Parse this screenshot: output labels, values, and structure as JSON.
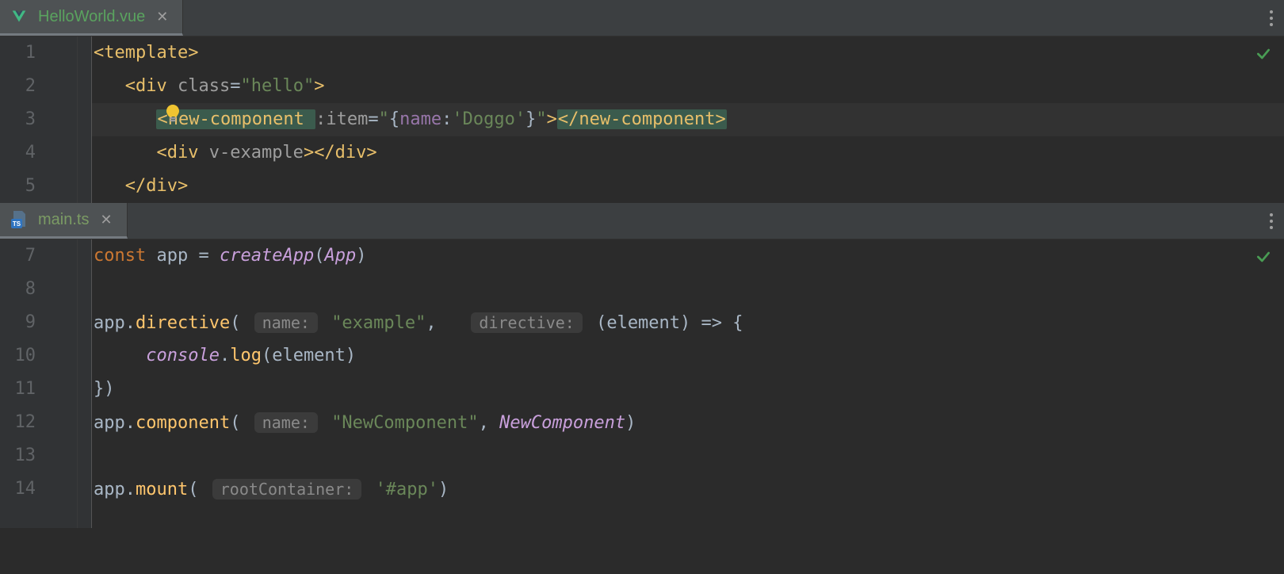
{
  "pane1": {
    "tab": {
      "title": "HelloWorld.vue"
    },
    "lines": {
      "l1": {
        "num": "1",
        "t_open": "<template>"
      },
      "l2": {
        "num": "2",
        "div_open": "<div ",
        "class_attr": "class",
        "eq": "=",
        "class_val": "\"hello\"",
        "close": ">"
      },
      "l3": {
        "num": "3",
        "nc_open": "<new-component ",
        "item_attr": ":item",
        "eq": "=",
        "q1": "\"",
        "brace1": "{",
        "name_key": "name",
        "colon": ":",
        "name_val": "'Doggo'",
        "brace2": "}",
        "q2": "\"",
        "tag_close": ">",
        "nc_close": "</new-component>"
      },
      "l4": {
        "num": "4",
        "div_open": "<div ",
        "vex": "v-example",
        "close": ">",
        "div_close": "</div>"
      },
      "l5": {
        "num": "5",
        "div_close": "</div>"
      }
    }
  },
  "pane2": {
    "tab": {
      "title": "main.ts"
    },
    "lines": {
      "l7": {
        "num": "7",
        "const_kw": "const ",
        "app": "app",
        "eq": " = ",
        "createApp": "createApp",
        "popen": "(",
        "App": "App",
        "pclose": ")"
      },
      "l8": {
        "num": "8"
      },
      "l9": {
        "num": "9",
        "app": "app",
        "dot": ".",
        "directive": "directive",
        "popen": "(",
        "hint_name": "name:",
        "name_val": "\"example\"",
        "comma": ", ",
        "hint_dir": "directive:",
        "arrow_args": "(element) ",
        "arrow": "=> {"
      },
      "l10": {
        "num": "10",
        "console": "console",
        "dot": ".",
        "log": "log",
        "popen": "(",
        "element": "element",
        "pclose": ")"
      },
      "l11": {
        "num": "11",
        "close": "})"
      },
      "l12": {
        "num": "12",
        "app": "app",
        "dot": ".",
        "component": "component",
        "popen": "(",
        "hint_name": "name:",
        "name_val": "\"NewComponent\"",
        "comma": ", ",
        "NewComponent": "NewComponent",
        "pclose": ")"
      },
      "l13": {
        "num": "13"
      },
      "l14": {
        "num": "14",
        "app": "app",
        "dot": ".",
        "mount": "mount",
        "popen": "(",
        "hint_root": "rootContainer:",
        "root_val": "'#app'",
        "pclose": ")"
      }
    }
  }
}
